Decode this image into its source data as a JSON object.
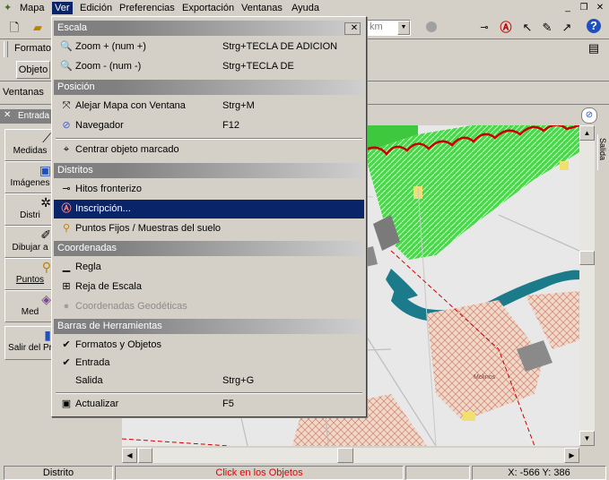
{
  "menubar": {
    "items": [
      {
        "label": "Mapa"
      },
      {
        "label": "Ver"
      },
      {
        "label": "Edición"
      },
      {
        "label": "Preferencias"
      },
      {
        "label": "Exportación"
      },
      {
        "label": "Ventanas"
      },
      {
        "label": "Ayuda"
      }
    ]
  },
  "toolbar": {
    "formatos_label": "Formatos",
    "objeto_label": "Objeto",
    "unit_value": "km",
    "ventanas_label": "Ventanas"
  },
  "left_panel": {
    "header": "Entrada",
    "buttons": [
      {
        "label": "Medidas"
      },
      {
        "label": "Imágenes"
      },
      {
        "label": "Distri"
      },
      {
        "label": "Dibujar a"
      },
      {
        "label": "Puntos"
      },
      {
        "label": "Med"
      },
      {
        "label": "Salir del Pr"
      }
    ]
  },
  "right_tab": {
    "label": "Salida"
  },
  "menu": {
    "sections": {
      "escala": "Escala",
      "posicion": "Posición",
      "distritos": "Distritos",
      "coordenadas": "Coordenadas",
      "barras": "Barras de Herramientas"
    },
    "items": {
      "zoom_in": {
        "label": "Zoom +  (num +)",
        "shortcut": "Strg+TECLA DE ADICION"
      },
      "zoom_out": {
        "label": "Zoom -  (num -)",
        "shortcut": "Strg+TECLA DE SUSTRACCION"
      },
      "alejar": {
        "label": "Alejar Mapa con Ventana",
        "shortcut": "Strg+M"
      },
      "navegador": {
        "label": "Navegador",
        "shortcut": "F12"
      },
      "centrar": {
        "label": "Centrar objeto marcado",
        "shortcut": ""
      },
      "hitos": {
        "label": "Hitos fronterizo",
        "shortcut": ""
      },
      "inscripcion": {
        "label": "Inscripción...",
        "shortcut": ""
      },
      "puntos": {
        "label": "Puntos Fijos / Muestras del suelo",
        "shortcut": ""
      },
      "regla": {
        "label": "Regla",
        "shortcut": ""
      },
      "reja": {
        "label": "Reja de Escala",
        "shortcut": ""
      },
      "geodeticas": {
        "label": "Coordenadas Geodéticas",
        "shortcut": ""
      },
      "formatos": {
        "label": "Formatos y Objetos",
        "shortcut": ""
      },
      "entrada": {
        "label": "Entrada",
        "shortcut": ""
      },
      "salida": {
        "label": "Salida",
        "shortcut": "Strg+G"
      },
      "actualizar": {
        "label": "Actualizar",
        "shortcut": "F5"
      }
    }
  },
  "map": {
    "labels": [
      "Molinos"
    ]
  },
  "status": {
    "mode": "Distrito",
    "hint": "Click en los Objetos",
    "coords": "X: -566  Y: 386",
    "hint_color": "#e00000"
  },
  "colors": {
    "menu_highlight": "#0a246a",
    "map_green": "#45d845",
    "map_water": "#1c7b8a",
    "map_red_border": "#cc0000",
    "map_hatch": "#e8b8a0"
  }
}
